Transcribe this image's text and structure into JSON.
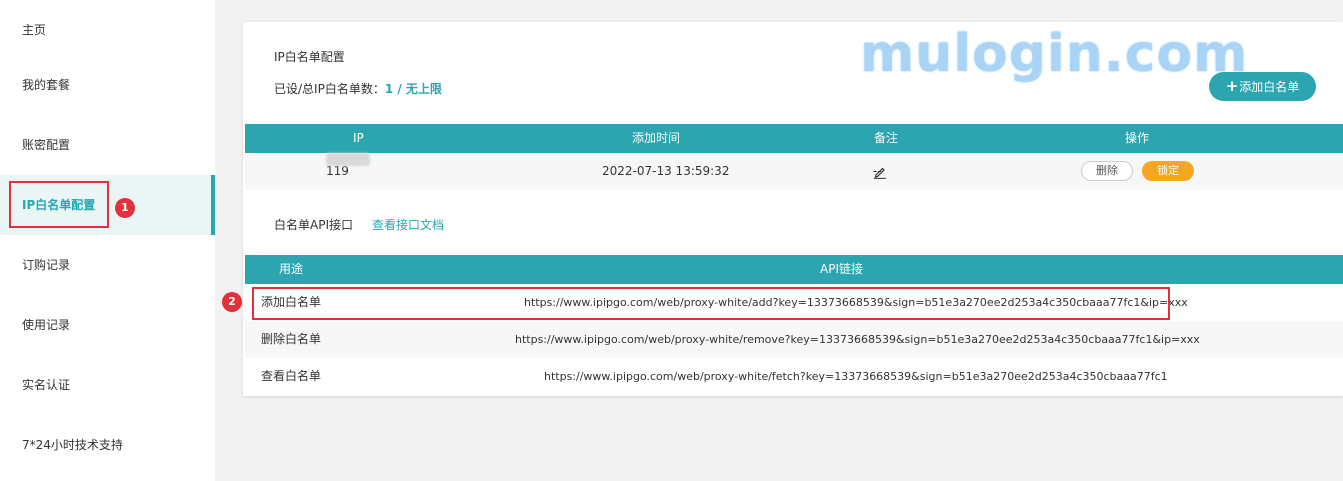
{
  "sidebar": {
    "items": [
      {
        "label": "主页"
      },
      {
        "label": "我的套餐"
      },
      {
        "label": "账密配置"
      },
      {
        "label": "IP白名单配置"
      },
      {
        "label": "订购记录"
      },
      {
        "label": "使用记录"
      },
      {
        "label": "实名认证"
      },
      {
        "label": "7*24小时技术支持"
      }
    ],
    "active_index": 3
  },
  "annotations": {
    "badge1": "1",
    "badge2": "2",
    "color": "#e0323a"
  },
  "watermark": "mulogin.com",
  "header": {
    "title": "IP白名单配置",
    "count_label": "已设/总IP白名单数：",
    "count_value": "1 / 无上限",
    "add_button": "添加白名单"
  },
  "whitelist_table": {
    "columns": [
      "IP",
      "添加时间",
      "备注",
      "操作"
    ],
    "rows": [
      {
        "ip": "119",
        "time": "2022-07-13 13:59:32",
        "note": "--",
        "delete": "删除",
        "lock": "锁定"
      }
    ]
  },
  "api_section": {
    "label": "白名单API接口",
    "doc_link": "查看接口文档"
  },
  "api_table": {
    "columns": [
      "用途",
      "API链接"
    ],
    "rows": [
      {
        "purpose": "添加白名单",
        "url": "https://www.ipipgo.com/web/proxy-white/add?key=13373668539&sign=b51e3a270ee2d253a4c350cbaaa77fc1&ip=xxx"
      },
      {
        "purpose": "删除白名单",
        "url": "https://www.ipipgo.com/web/proxy-white/remove?key=13373668539&sign=b51e3a270ee2d253a4c350cbaaa77fc1&ip=xxx"
      },
      {
        "purpose": "查看白名单",
        "url": "https://www.ipipgo.com/web/proxy-white/fetch?key=13373668539&sign=b51e3a270ee2d253a4c350cbaaa77fc1"
      }
    ]
  },
  "colors": {
    "accent": "#2ba6b0",
    "lock_button": "#f5a623",
    "annotation": "#e0323a"
  },
  "icons": {
    "add": "plus-icon",
    "edit_note": "pencil-icon"
  }
}
